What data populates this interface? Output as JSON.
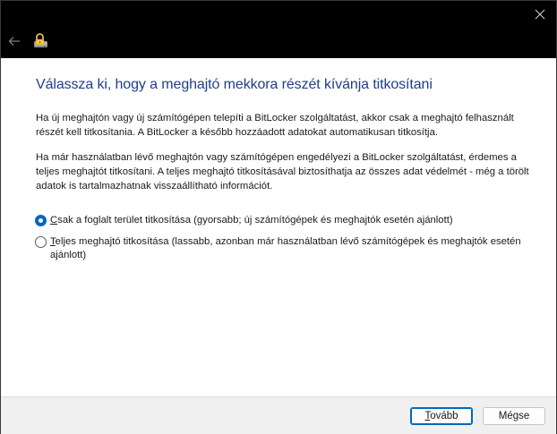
{
  "window": {
    "close_glyph": "✕",
    "back_glyph": "←"
  },
  "heading": "Válassza ki, hogy a meghajtó mekkora részét kívánja titkosítani",
  "paragraphs": [
    "Ha új meghajtón vagy új számítógépen telepíti a BitLocker szolgáltatást, akkor csak a meghajtó felhasznált részét kell titkosítania. A BitLocker a később hozzáadott adatokat automatikusan titkosítja.",
    "Ha már használatban lévő meghajtón vagy számítógépen engedélyezi a BitLocker szolgáltatást, érdemes a teljes meghajtót titkosítani. A teljes meghajtó titkosításával biztosíthatja az összes adat védelmét - még a törölt adatok is tartalmazhatnak visszaállítható információt."
  ],
  "options": [
    {
      "label": "Csak a foglalt terület titkosítása (gyorsabb; új számítógépek és meghajtók esetén ajánlott)",
      "checked": true
    },
    {
      "label": "Teljes meghajtó titkosítása (lassabb, azonban már használatban lévő számítógépek és meghajtók esetén ajánlott)",
      "checked": false
    }
  ],
  "buttons": {
    "next": "Tovább",
    "cancel": "Mégse"
  },
  "colors": {
    "accent": "#0067c0",
    "heading": "#1e3f8a",
    "titlebar": "#000000"
  }
}
